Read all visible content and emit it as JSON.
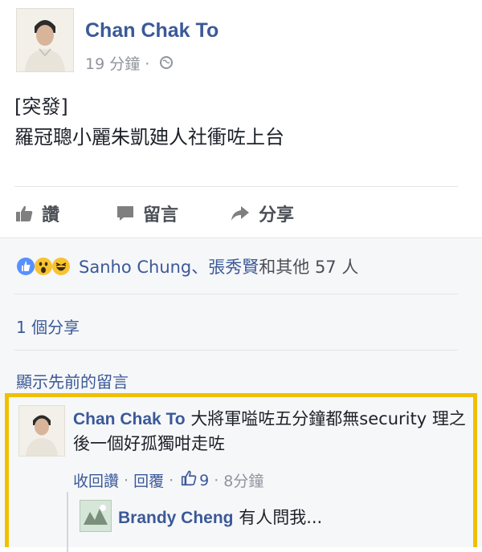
{
  "post": {
    "author": "Chan Chak To",
    "time": "19 分鐘",
    "separator": "·",
    "privacy_icon": "globe-icon",
    "text_line1": "[突發]",
    "text_line2": "羅冠聰小麗朱凱廸人社衝咗上台"
  },
  "actions": {
    "like": "讚",
    "comment": "留言",
    "share": "分享"
  },
  "reactions": {
    "icons": [
      "like-reaction-icon",
      "wow-reaction-icon",
      "haha-reaction-icon"
    ],
    "names": "Sanho Chung、張秀賢",
    "suffix": "和其他 57 人"
  },
  "shares_text": "1 個分享",
  "previous_comments": "顯示先前的留言",
  "comment": {
    "author": "Chan Chak To",
    "text": "大將軍嗌咗五分鐘都無security 理之後一個好孤獨咁走咗",
    "unlike": "收回讚",
    "reply": "回覆",
    "like_count": "9",
    "time": "8分鐘",
    "dot": "·"
  },
  "reply": {
    "author": "Brandy Cheng",
    "text": "有人問我..."
  },
  "colors": {
    "link": "#3b5998",
    "highlight_border": "#f0c000",
    "meta": "#90949c"
  }
}
